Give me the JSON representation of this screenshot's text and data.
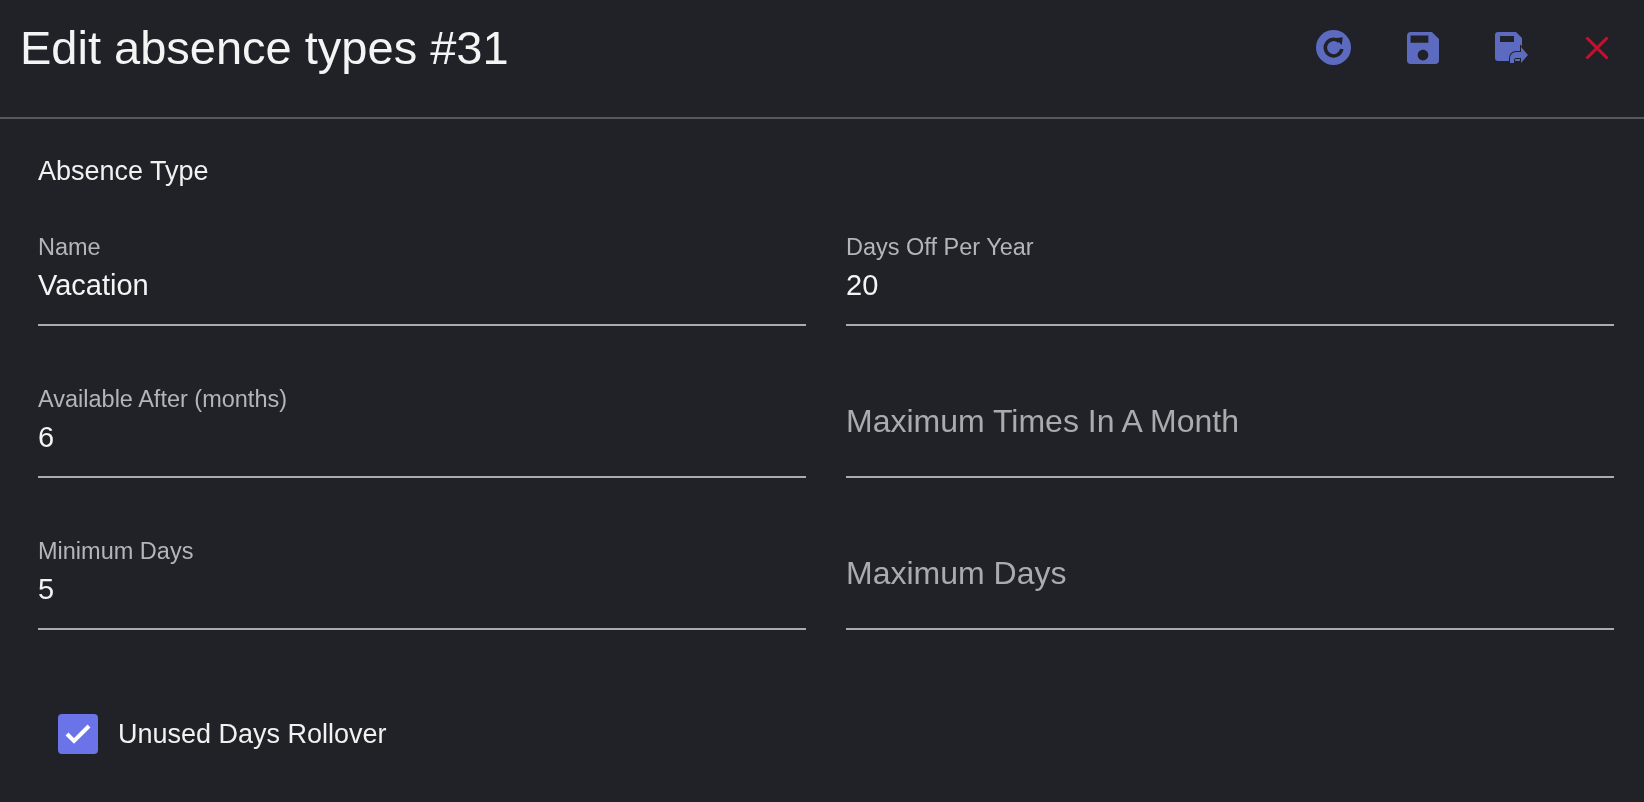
{
  "header": {
    "title": "Edit absence types #31",
    "actions": [
      {
        "kind": "refresh"
      },
      {
        "kind": "save"
      },
      {
        "kind": "save_forward"
      },
      {
        "kind": "close"
      }
    ]
  },
  "form": {
    "section_title": "Absence Type",
    "fields": [
      {
        "label": "Name",
        "value": "Vacation"
      },
      {
        "label": "Days Off Per Year",
        "value": "20"
      },
      {
        "label": "Available After (months)",
        "value": "6"
      },
      {
        "placeholder": "Maximum Times In A Month"
      },
      {
        "label": "Minimum Days",
        "value": "5"
      },
      {
        "placeholder": "Maximum Days"
      }
    ],
    "checkbox": {
      "label": "Unused Days Rollover",
      "checked": true
    }
  }
}
